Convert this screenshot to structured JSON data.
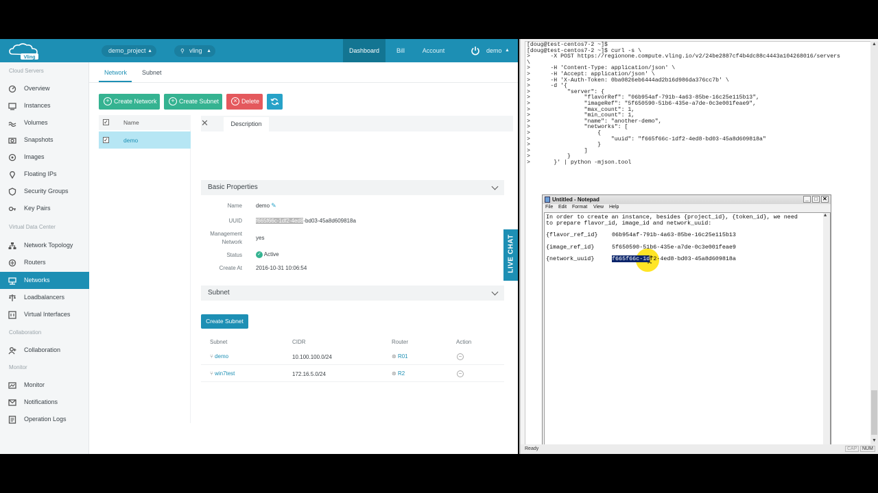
{
  "topbar": {
    "logo_text": "Vling",
    "project": "demo_project",
    "region": "vling",
    "nav": [
      "Dashboard",
      "Bill",
      "Account"
    ],
    "user": "demo"
  },
  "sidebar": {
    "sections": [
      {
        "title": "Cloud Servers",
        "items": [
          {
            "label": "Overview",
            "icon": "overview-icon"
          },
          {
            "label": "Instances",
            "icon": "instances-icon"
          },
          {
            "label": "Volumes",
            "icon": "volumes-icon"
          },
          {
            "label": "Snapshots",
            "icon": "camera-icon"
          },
          {
            "label": "Images",
            "icon": "image-icon"
          },
          {
            "label": "Floating IPs",
            "icon": "pin-icon"
          },
          {
            "label": "Security Groups",
            "icon": "shield-icon"
          },
          {
            "label": "Key Pairs",
            "icon": "key-icon"
          }
        ]
      },
      {
        "title": "Virtual Data Center",
        "items": [
          {
            "label": "Network Topology",
            "icon": "topology-icon"
          },
          {
            "label": "Routers",
            "icon": "router-icon"
          },
          {
            "label": "Networks",
            "icon": "network-icon",
            "active": true
          },
          {
            "label": "Loadbalancers",
            "icon": "balance-icon"
          },
          {
            "label": "Virtual Interfaces",
            "icon": "interface-icon"
          }
        ]
      },
      {
        "title": "Collaboration",
        "items": [
          {
            "label": "Collaboration",
            "icon": "collaboration-icon"
          }
        ]
      },
      {
        "title": "Monitor",
        "items": [
          {
            "label": "Monitor",
            "icon": "monitor-icon"
          },
          {
            "label": "Notifications",
            "icon": "notifications-icon"
          },
          {
            "label": "Operation Logs",
            "icon": "logs-icon"
          }
        ]
      }
    ]
  },
  "main": {
    "tabs": [
      "Network",
      "Subnet"
    ],
    "buttons": {
      "create_network": "Create Network",
      "create_subnet": "Create Subnet",
      "delete": "Delete"
    },
    "list": {
      "header": "Name",
      "rows": [
        "demo"
      ]
    },
    "detail": {
      "tab": "Description",
      "basic_title": "Basic Properties",
      "fields": {
        "name_label": "Name",
        "name_value": "demo",
        "uuid_label": "UUID",
        "uuid_selected": "f665f66c-1df2-4ed8",
        "uuid_rest": "-bd03-45a8d609818a",
        "mgmt_label_1": "Management",
        "mgmt_label_2": "Network",
        "mgmt_value": "yes",
        "status_label": "Status",
        "status_value": "Active",
        "created_label": "Create At",
        "created_value": "2016-10-31 10:06:54"
      },
      "subnet_title": "Subnet",
      "create_subnet": "Create Subnet",
      "subnet_table": {
        "headers": [
          "Subnet",
          "CIDR",
          "Router",
          "Action"
        ],
        "rows": [
          {
            "subnet": "demo",
            "cidr": "10.100.100.0/24",
            "router": "R01"
          },
          {
            "subnet": "win7test",
            "cidr": "172.16.5.0/24",
            "router": "R2"
          }
        ]
      }
    },
    "live_chat": "LIVE CHAT"
  },
  "terminal": {
    "lines": [
      "[doug@test-centos7-2 ~]$",
      "[doug@test-centos7-2 ~]$ curl -s \\",
      ">      -X POST https://regionone.compute.vling.io/v2/24be2887cf4b4dc88c4443a104268016/servers",
      "\\",
      ">      -H 'Content-Type: application/json' \\",
      ">      -H 'Accept: application/json' \\",
      ">      -H 'X-Auth-Token: 0ba0826eb6444ad2b16d986da376cc7b' \\",
      ">      -d '{",
      ">           \"server\": {",
      ">                \"flavorRef\": \"06b954af-791b-4a63-85be-16c25e115b13\",",
      ">                \"imageRef\": \"5f650590-51b6-435e-a7de-0c3e001feae9\",",
      ">                \"max_count\": 1,",
      ">                \"min_count\": 1,",
      ">                \"name\": \"another-demo\",",
      ">                \"networks\": [",
      ">                    {",
      ">                        \"uuid\": \"f665f66c-1df2-4ed8-bd03-45a8d609818a\"",
      ">                    }",
      ">                ]",
      ">           }",
      ">       }' | python -mjson.tool"
    ],
    "status_left": "Ready",
    "status_right": [
      "CAP",
      "NUM"
    ]
  },
  "notepad": {
    "title": "Untitled - Notepad",
    "menu": [
      "File",
      "Edit",
      "Format",
      "View",
      "Help"
    ],
    "lines": [
      "In order to create an instance, besides {project_id}, {token_id}, we need",
      "to prepare flavor_id, image_id and network_uuid:"
    ],
    "pairs": [
      {
        "key": "{flavor_ref_id}",
        "value": "06b954af-791b-4a63-85be-16c25e115b13"
      },
      {
        "key": "{image_ref_id}",
        "value": "5f650590-51b6-435e-a7de-0c3e001feae9"
      },
      {
        "key": "{network_uuid}",
        "value_selected": "f665f66c-1d",
        "value_rest": "f2-4ed8-bd03-45a8d609818a"
      }
    ],
    "colors": {
      "selection": "#0a246a",
      "cursor_highlight": "#ffe100"
    }
  },
  "colors": {
    "brand": "#1d8fb4",
    "green": "#35b391",
    "red": "#e4595d"
  }
}
